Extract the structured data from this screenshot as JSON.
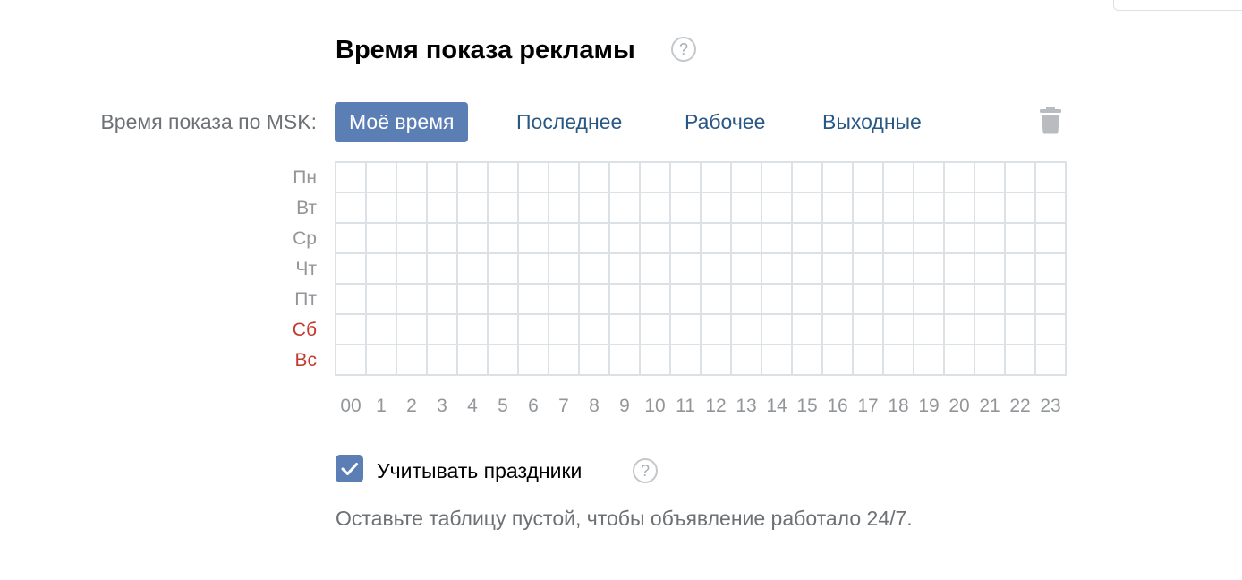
{
  "section": {
    "title": "Время показа рекламы",
    "help_glyph": "?"
  },
  "schedule": {
    "row_label": "Время показа по MSK:",
    "presets": [
      {
        "label": "Моё время",
        "active": true
      },
      {
        "label": "Последнее",
        "active": false
      },
      {
        "label": "Рабочее",
        "active": false
      },
      {
        "label": "Выходные",
        "active": false
      }
    ],
    "clear_icon": "trash-icon",
    "days": [
      {
        "label": "Пн",
        "weekend": false
      },
      {
        "label": "Вт",
        "weekend": false
      },
      {
        "label": "Ср",
        "weekend": false
      },
      {
        "label": "Чт",
        "weekend": false
      },
      {
        "label": "Пт",
        "weekend": false
      },
      {
        "label": "Сб",
        "weekend": true
      },
      {
        "label": "Вс",
        "weekend": true
      }
    ],
    "hours": [
      "00",
      "1",
      "2",
      "3",
      "4",
      "5",
      "6",
      "7",
      "8",
      "9",
      "10",
      "11",
      "12",
      "13",
      "14",
      "15",
      "16",
      "17",
      "18",
      "19",
      "20",
      "21",
      "22",
      "23"
    ],
    "selected_cells": []
  },
  "holidays": {
    "label": "Учитывать праздники",
    "checked": true,
    "help_glyph": "?"
  },
  "hint": "Оставьте таблицу пустой, чтобы объявление работало 24/7.",
  "colors": {
    "accent": "#5b7fb5",
    "link": "#2a5885",
    "weekend": "#c23b31",
    "grid_border": "#dce1e6",
    "muted": "#939699"
  }
}
